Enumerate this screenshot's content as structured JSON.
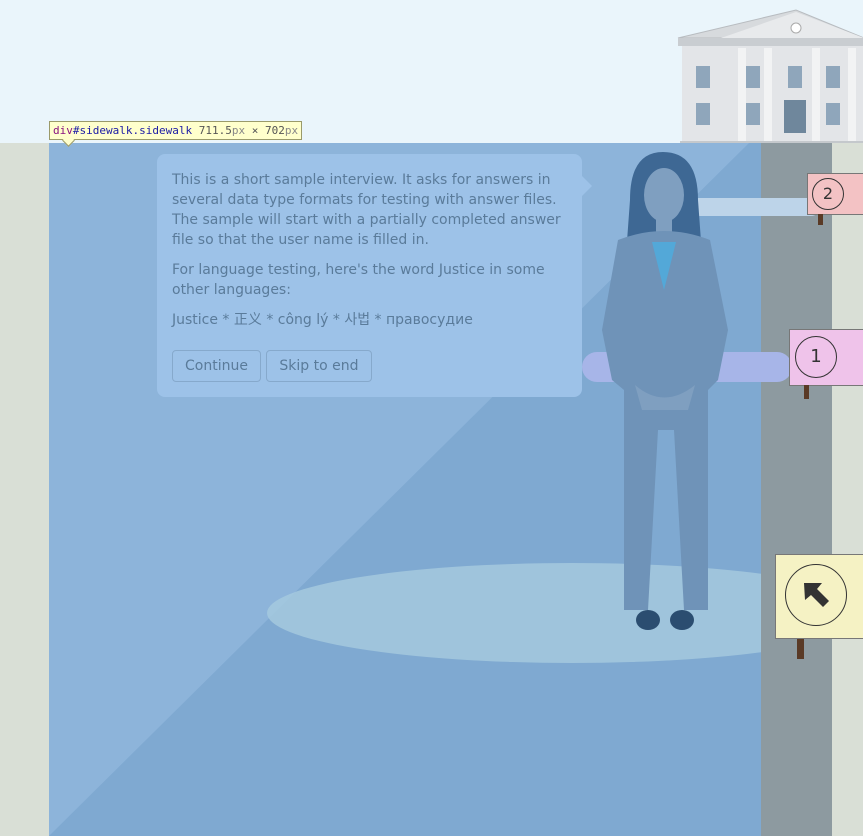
{
  "inspector": {
    "tag": "div",
    "id_part": "#sidewalk",
    "class_part": ".sidewalk",
    "width": "711.5",
    "height": "702",
    "unit": "px",
    "times": "×"
  },
  "dialog": {
    "paragraph_1": "This is a short sample interview. It asks for answers in several data type formats for testing with answer files. The sample will start with a partially completed answer file so that the user name is filled in.",
    "paragraph_2": "For language testing, here's the word Justice in some other languages:",
    "paragraph_3": "Justice * 正义 * công lý * 사법 * правосудие",
    "continue_label": "Continue",
    "skip_label": "Skip to end"
  },
  "signs": [
    {
      "number": "2",
      "color": "#f3c2c4"
    },
    {
      "number": "1",
      "color": "#efc3ea"
    },
    {
      "number": "",
      "icon": "arrow-up-left-icon",
      "color": "#f5f2c4"
    }
  ],
  "colors": {
    "sidewalk": "#7fa9d1",
    "street": "#8d9aa0",
    "sky": "#eaf5fb"
  }
}
